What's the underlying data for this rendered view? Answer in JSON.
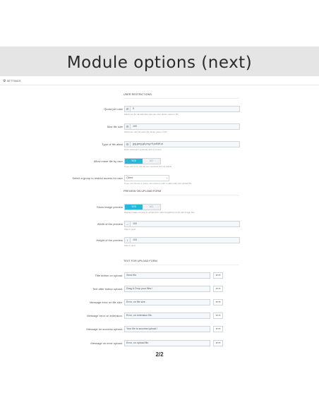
{
  "page_title": "Module options (next)",
  "pager": "2/2",
  "panel": {
    "header_icon": "gear-icon",
    "header_label": "SETTINGS"
  },
  "sections": {
    "user_restrictions": "USER RESTRICTIONS",
    "preview": "PREVIEW ON UPLOAD FORM",
    "text": "TEXT FOR UPLOAD FORM"
  },
  "fields": {
    "quota": {
      "label": "Quota per user",
      "addon": "⚙",
      "value": "5",
      "help": "Maximum for all total files size per user. Enter value in Mo."
    },
    "max_file_size": {
      "label": "Max file size",
      "addon": "⚙",
      "value": "100",
      "help": "Maximum size for each file. Enter value in Mo."
    },
    "file_types": {
      "label": "Type of file allow",
      "addon": "⚙",
      "value": "jpg,jpeg,gif,png,rtf,pdf,tiff,ai",
      "help": "Enter extension separate with a comma"
    },
    "allow_erase": {
      "label": "Allow erase file by user",
      "yes": "YES",
      "no": "NO",
      "help": "If you set to no, the file are uncancel but not delete."
    },
    "group_restrict": {
      "label": "Select a group to restrict access for user",
      "value": "Client",
      "arrow": "↕",
      "help": "If you not choose a group, all customer with a valid order can upload file"
    },
    "show_preview": {
      "label": "Show image preview",
      "yes": "YES",
      "no": "NO",
      "help": "Display image preview in upload form after drag&drop (only with image file)"
    },
    "preview_width": {
      "label": "Width of the preview",
      "addon": "↔",
      "value": "100",
      "help": "Size in pixel"
    },
    "preview_height": {
      "label": "Height of the preview",
      "addon": "↕",
      "value": "100",
      "help": "Size in pixel"
    },
    "title_button": {
      "label": "Title button on upload.",
      "value": "Send file.",
      "lang": "en ▾"
    },
    "text_after_button": {
      "label": "Text after button upload.",
      "value": "Drag & Drop your files !",
      "lang": "en ▾"
    },
    "error_file_size": {
      "label": "Message error on file size.",
      "value": "Error, on file size.",
      "lang": "en ▾"
    },
    "error_extension": {
      "label": "Message error on extension.",
      "value": "Error, on extension file.",
      "lang": "en ▾"
    },
    "success_upload": {
      "label": "Message on success upload.",
      "value": "Your file is success upload !",
      "lang": "en ▾"
    },
    "error_upload": {
      "label": "Message on error upload.",
      "value": "Error, on upload file.",
      "lang": "en ▾"
    }
  },
  "colors": {
    "toggle_on": "#25b9d7",
    "input_bg": "#f4f8fb"
  }
}
